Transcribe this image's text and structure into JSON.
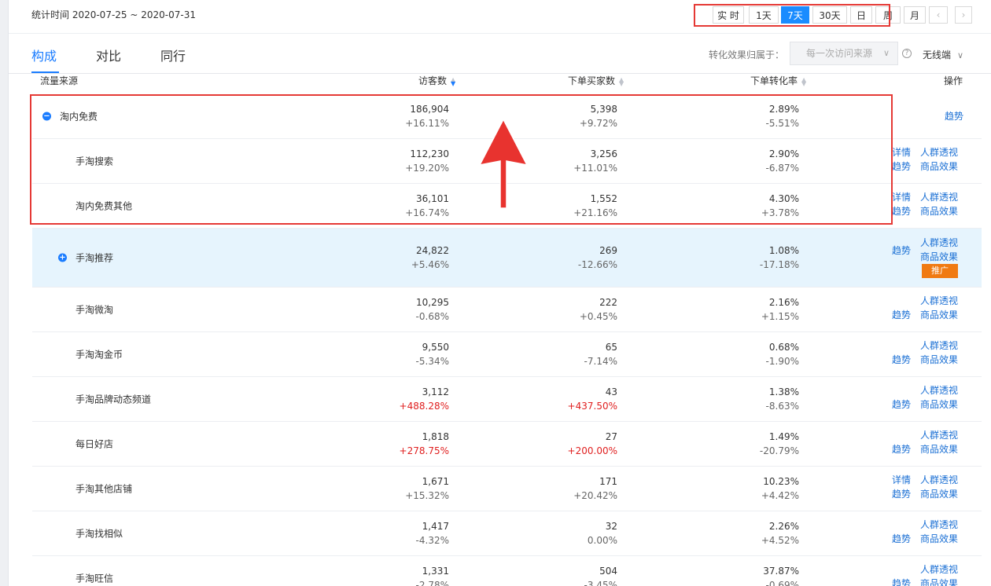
{
  "header": {
    "stat_time": "统计时间 2020-07-25 ~ 2020-07-31"
  },
  "range_buttons": [
    {
      "label": "实 时",
      "active": false
    },
    {
      "label": "1天",
      "active": false
    },
    {
      "label": "7天",
      "active": true
    },
    {
      "label": "30天",
      "active": false
    },
    {
      "label": "日",
      "active": false
    },
    {
      "label": "周",
      "active": false
    },
    {
      "label": "月",
      "active": false
    },
    {
      "label": "‹",
      "active": false
    },
    {
      "label": "›",
      "active": false
    }
  ],
  "tabs": [
    {
      "label": "构成",
      "active": true
    },
    {
      "label": "对比",
      "active": false
    },
    {
      "label": "同行",
      "active": false
    }
  ],
  "conversion": {
    "label": "转化效果归属于：",
    "select_value": "每一次访问来源",
    "device_value": "无线端"
  },
  "table": {
    "headers": {
      "source": "流量来源",
      "visitors": "访客数",
      "buyers": "下单买家数",
      "rate": "下单转化率",
      "ops": "操作"
    },
    "rows": [
      {
        "name": "淘内免费",
        "level": 1,
        "toggle": "−",
        "visitors": "186,904",
        "visitors_delta": "+16.11%",
        "buyers": "5,398",
        "buyers_delta": "+9.72%",
        "rate": "2.89%",
        "rate_delta": "-5.51%",
        "ops": [
          "趋势"
        ]
      },
      {
        "name": "手淘搜索",
        "level": 2,
        "visitors": "112,230",
        "visitors_delta": "+19.20%",
        "buyers": "3,256",
        "buyers_delta": "+11.01%",
        "rate": "2.90%",
        "rate_delta": "-6.87%",
        "ops": [
          "详情",
          "人群透视",
          "趋势",
          "商品效果"
        ]
      },
      {
        "name": "淘内免费其他",
        "level": 2,
        "visitors": "36,101",
        "visitors_delta": "+16.74%",
        "buyers": "1,552",
        "buyers_delta": "+21.16%",
        "rate": "4.30%",
        "rate_delta": "+3.78%",
        "ops": [
          "详情",
          "人群透视",
          "趋势",
          "商品效果"
        ]
      },
      {
        "name": "手淘推荐",
        "level": 1,
        "toggle": "+",
        "highlight": true,
        "visitors": "24,822",
        "visitors_delta": "+5.46%",
        "buyers": "269",
        "buyers_delta": "-12.66%",
        "rate": "1.08%",
        "rate_delta": "-17.18%",
        "ops": [
          "人群透视",
          "趋势",
          "商品效果"
        ],
        "promo": "推广"
      },
      {
        "name": "手淘微淘",
        "level": 2,
        "visitors": "10,295",
        "visitors_delta": "-0.68%",
        "buyers": "222",
        "buyers_delta": "+0.45%",
        "rate": "2.16%",
        "rate_delta": "+1.15%",
        "ops": [
          "人群透视",
          "趋势",
          "商品效果"
        ]
      },
      {
        "name": "手淘淘金币",
        "level": 2,
        "visitors": "9,550",
        "visitors_delta": "-5.34%",
        "buyers": "65",
        "buyers_delta": "-7.14%",
        "rate": "0.68%",
        "rate_delta": "-1.90%",
        "ops": [
          "人群透视",
          "趋势",
          "商品效果"
        ]
      },
      {
        "name": "手淘品牌动态频道",
        "level": 2,
        "visitors": "3,112",
        "visitors_delta": "+488.28%",
        "visitors_up": true,
        "buyers": "43",
        "buyers_delta": "+437.50%",
        "buyers_up": true,
        "rate": "1.38%",
        "rate_delta": "-8.63%",
        "ops": [
          "人群透视",
          "趋势",
          "商品效果"
        ]
      },
      {
        "name": "每日好店",
        "level": 2,
        "visitors": "1,818",
        "visitors_delta": "+278.75%",
        "visitors_up": true,
        "buyers": "27",
        "buyers_delta": "+200.00%",
        "buyers_up": true,
        "rate": "1.49%",
        "rate_delta": "-20.79%",
        "ops": [
          "人群透视",
          "趋势",
          "商品效果"
        ]
      },
      {
        "name": "手淘其他店铺",
        "level": 2,
        "visitors": "1,671",
        "visitors_delta": "+15.32%",
        "buyers": "171",
        "buyers_delta": "+20.42%",
        "rate": "10.23%",
        "rate_delta": "+4.42%",
        "ops": [
          "详情",
          "人群透视",
          "趋势",
          "商品效果"
        ]
      },
      {
        "name": "手淘找相似",
        "level": 2,
        "visitors": "1,417",
        "visitors_delta": "-4.32%",
        "buyers": "32",
        "buyers_delta": "0.00%",
        "rate": "2.26%",
        "rate_delta": "+4.52%",
        "ops": [
          "人群透视",
          "趋势",
          "商品效果"
        ]
      },
      {
        "name": "手淘旺信",
        "level": 2,
        "visitors": "1,331",
        "visitors_delta": "-2.78%",
        "buyers": "504",
        "buyers_delta": "-3.45%",
        "rate": "37.87%",
        "rate_delta": "-0.69%",
        "ops": [
          "人群透视",
          "趋势",
          "商品效果"
        ]
      }
    ]
  }
}
